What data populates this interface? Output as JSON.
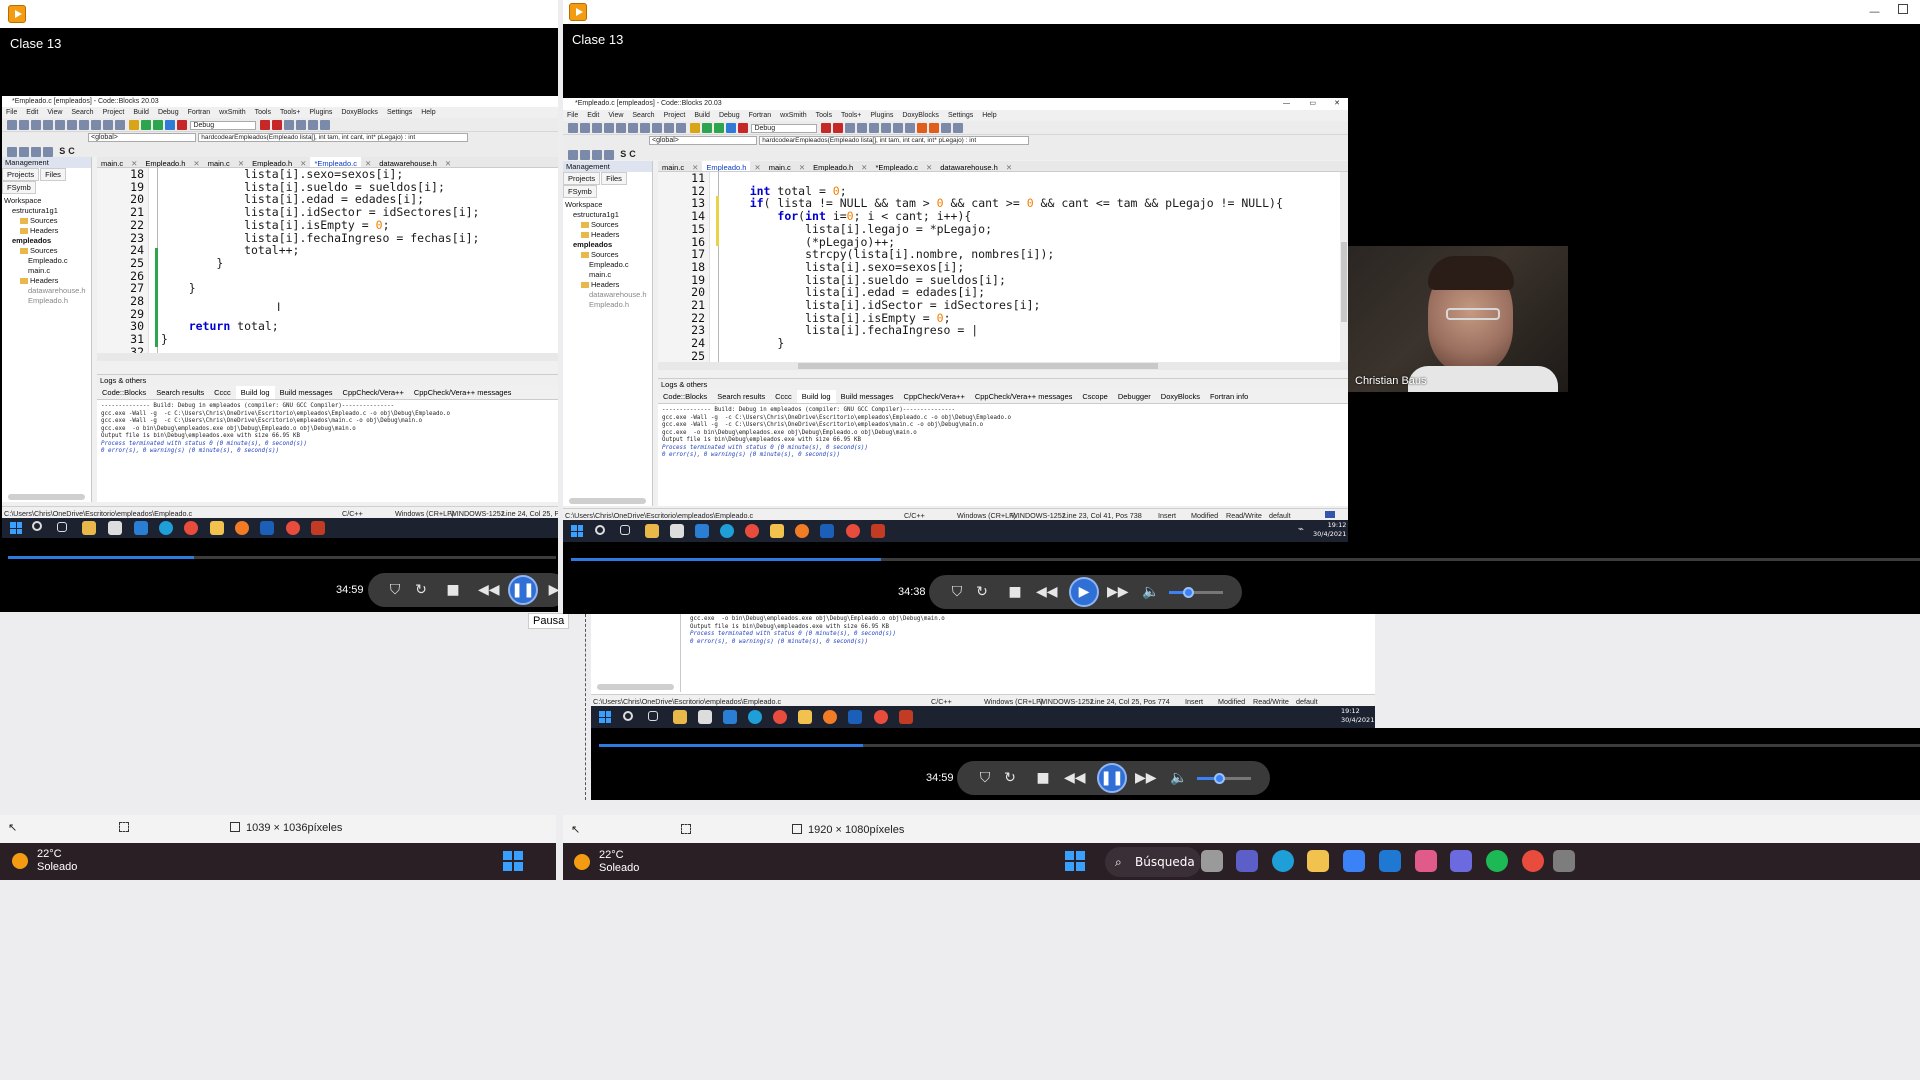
{
  "left_player": {
    "window_title": "Clase 13",
    "time": "34:59",
    "progress": 0.34,
    "tooltip": "Pausa"
  },
  "right_player": {
    "window_title": "Clase 13",
    "time": "34:38",
    "progress": 0.23,
    "volume": 0.35,
    "presenter_name": "Christian Baus"
  },
  "inner_player": {
    "time": "34:59",
    "progress": 0.2,
    "volume": 0.4
  },
  "ide_left": {
    "title": "*Empleado.c [empleados] - Code::Blocks 20.03",
    "menu": [
      "File",
      "Edit",
      "View",
      "Search",
      "Project",
      "Build",
      "Debug",
      "Fortran",
      "wxSmith",
      "Tools",
      "Tools+",
      "Plugins",
      "DoxyBlocks",
      "Settings",
      "Help"
    ],
    "build_target": "Debug",
    "scope": "<global>",
    "function_sig": "hardcodearEmpleados(Empleado lista[], int tam, int cant, int* pLegajo) : int",
    "file_tabs": [
      "main.c",
      "Empleado.h",
      "main.c",
      "Empleado.h",
      "*Empleado.c",
      "datawarehouse.h"
    ],
    "active_tab": 4,
    "mgmt_title": "Management",
    "mgmt_tabs": [
      "Projects",
      "Files",
      "FSymb"
    ],
    "tree": [
      "Workspace",
      "estructura1g1",
      "Sources",
      "Headers",
      "empleados",
      "Sources",
      "Empleado.c",
      "main.c",
      "Headers",
      "datawarehouse.h",
      "Empleado.h"
    ],
    "line_numbers": [
      "18",
      "19",
      "20",
      "21",
      "22",
      "23",
      "24",
      "25",
      "26",
      "27",
      "28",
      "29",
      "30",
      "31",
      "32"
    ],
    "code_lines": [
      "            lista[i].sexo=sexos[i];",
      "            lista[i].sueldo = sueldos[i];",
      "            lista[i].edad = edades[i];",
      "            lista[i].idSector = idSectores[i];",
      "            lista[i].isEmpty = 0;",
      "            lista[i].fechaIngreso = fechas[i];",
      "            total++;",
      "        }",
      "",
      "    }",
      "",
      "",
      "    return total;",
      "}",
      ""
    ],
    "logs_title": "Logs & others",
    "log_tabs": [
      "Code::Blocks",
      "Search results",
      "Cccc",
      "Build log",
      "Build messages",
      "CppCheck/Vera++",
      "CppCheck/Vera++ messages"
    ],
    "active_log": 3,
    "log_lines": [
      "-------------- Build: Debug in empleados (compiler: GNU GCC Compiler)---------------",
      "gcc.exe -Wall -g  -c C:\\Users\\Chris\\OneDrive\\Escritorio\\empleados\\Empleado.c -o obj\\Debug\\Empleado.o",
      "gcc.exe -Wall -g  -c C:\\Users\\Chris\\OneDrive\\Escritorio\\empleados\\main.c -o obj\\Debug\\main.o",
      "gcc.exe  -o bin\\Debug\\empleados.exe obj\\Debug\\Empleado.o obj\\Debug\\main.o",
      "Output file is bin\\Debug\\empleados.exe with size 66.95 KB",
      "Process terminated with status 0 (0 minute(s), 0 second(s))",
      "0 error(s), 0 warning(s) (0 minute(s), 0 second(s))"
    ],
    "status_path": "C:\\Users\\Chris\\OneDrive\\Escritorio\\empleados\\Empleado.c",
    "status_lang": "C/C++",
    "status_eol": "Windows (CR+LF)",
    "status_enc": "WINDOWS-1252",
    "status_pos": "Line 24, Col 25, Pos"
  },
  "ide_right": {
    "title": "*Empleado.c [empleados] - Code::Blocks 20.03",
    "menu": [
      "File",
      "Edit",
      "View",
      "Search",
      "Project",
      "Build",
      "Debug",
      "Fortran",
      "wxSmith",
      "Tools",
      "Tools+",
      "Plugins",
      "DoxyBlocks",
      "Settings",
      "Help"
    ],
    "build_target": "Debug",
    "scope": "<global>",
    "function_sig": "hardcodearEmpleados(Empleado lista[], int tam, int cant, int* pLegajo) : int",
    "file_tabs": [
      "main.c",
      "Empleado.h",
      "main.c",
      "Empleado.h",
      "*Empleado.c",
      "datawarehouse.h"
    ],
    "active_tab": 1,
    "mgmt_title": "Management",
    "mgmt_tabs": [
      "Projects",
      "Files",
      "FSymb"
    ],
    "tree": [
      "Workspace",
      "estructura1g1",
      "Sources",
      "Headers",
      "empleados",
      "Sources",
      "Empleado.c",
      "main.c",
      "Headers",
      "datawarehouse.h",
      "Empleado.h"
    ],
    "line_numbers": [
      "11",
      "12",
      "13",
      "14",
      "15",
      "16",
      "17",
      "18",
      "19",
      "20",
      "21",
      "22",
      "23",
      "24",
      "25"
    ],
    "code_lines": [
      "",
      "    int total = 0;",
      "    if( lista != NULL && tam > 0 && cant >= 0 && cant <= tam && pLegajo != NULL){",
      "        for(int i=0; i < cant; i++){",
      "            lista[i].legajo = *pLegajo;",
      "            (*pLegajo)++;",
      "            strcpy(lista[i].nombre, nombres[i]);",
      "            lista[i].sexo=sexos[i];",
      "            lista[i].sueldo = sueldos[i];",
      "            lista[i].edad = edades[i];",
      "            lista[i].idSector = idSectores[i];",
      "            lista[i].isEmpty = 0;",
      "            lista[i].fechaIngreso = |",
      "        }",
      ""
    ],
    "logs_title": "Logs & others",
    "log_tabs": [
      "Code::Blocks",
      "Search results",
      "Cccc",
      "Build log",
      "Build messages",
      "CppCheck/Vera++",
      "CppCheck/Vera++ messages",
      "Cscope",
      "Debugger",
      "DoxyBlocks",
      "Fortran info"
    ],
    "active_log": 3,
    "log_lines": [
      "-------------- Build: Debug in empleados (compiler: GNU GCC Compiler)---------------",
      "gcc.exe -Wall -g  -c C:\\Users\\Chris\\OneDrive\\Escritorio\\empleados\\Empleado.c -o obj\\Debug\\Empleado.o",
      "gcc.exe -Wall -g  -c C:\\Users\\Chris\\OneDrive\\Escritorio\\empleados\\main.c -o obj\\Debug\\main.o",
      "gcc.exe  -o bin\\Debug\\empleados.exe obj\\Debug\\Empleado.o obj\\Debug\\main.o",
      "Output file is bin\\Debug\\empleados.exe with size 66.95 KB",
      "Process terminated with status 0 (0 minute(s), 0 second(s))",
      "0 error(s), 0 warning(s) (0 minute(s), 0 second(s))"
    ],
    "status_path": "C:\\Users\\Chris\\OneDrive\\Escritorio\\empleados\\Empleado.c",
    "status_lang": "C/C++",
    "status_eol": "Windows (CR+LF)",
    "status_enc": "WINDOWS-1252",
    "status_pos": "Line 23, Col 41, Pos 738",
    "status_ins": "Insert",
    "status_mod": "Modified",
    "status_rw": "Read/Write",
    "status_def": "default"
  },
  "inner_ide": {
    "log_lines": [
      "gcc.exe  -o bin\\Debug\\empleados.exe obj\\Debug\\Empleado.o obj\\Debug\\main.o",
      "Output file is bin\\Debug\\empleados.exe with size 66.95 KB",
      "Process terminated with status 0 (0 minute(s), 0 second(s))",
      "0 error(s), 0 warning(s) (0 minute(s), 0 second(s))"
    ],
    "status_path": "C:\\Users\\Chris\\OneDrive\\Escritorio\\empleados\\Empleado.c",
    "status_lang": "C/C++",
    "status_eol": "Windows (CR+LF)",
    "status_enc": "WINDOWS-1252",
    "status_pos": "Line 24, Col 25, Pos 774",
    "status_ins": "Insert",
    "status_mod": "Modified",
    "status_rw": "Read/Write",
    "status_def": "default"
  },
  "recorded_clock": {
    "time": "19:12",
    "date": "30/4/2021"
  },
  "footer_left": {
    "dimensions": "1039 × 1036píxeles"
  },
  "footer_right": {
    "dimensions": "1920 × 1080píxeles"
  },
  "weather": {
    "temp": "22°C",
    "condition": "Soleado"
  },
  "taskbar": {
    "search_label": "Búsqueda"
  }
}
